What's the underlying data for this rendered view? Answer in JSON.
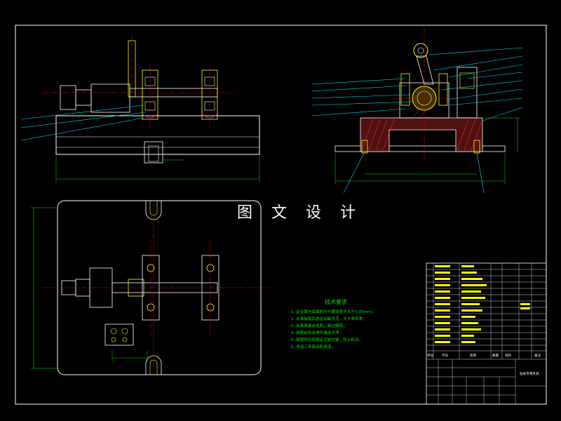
{
  "watermark": "图 文 设 计",
  "technical_requirements": {
    "title": "技术要求",
    "items": [
      "1. 定位面与底面的平行度误差不大于0.05mm；",
      "2. 夹具装配后各运动副灵活，无卡滞现象；",
      "3. 夹具表面去毛刺，锐边倒钝；",
      "4. 装配前所有零件清洗干净；",
      "5. 紧固件应按规定力矩拧紧，防止松动；",
      "6. 非加工表面涂防锈漆。"
    ]
  },
  "title_block": {
    "drawing_name": "钻床专用夹具",
    "columns": [
      "序号",
      "代号",
      "名称",
      "数量",
      "材料",
      "备注"
    ]
  },
  "colors": {
    "background": "#000000",
    "outline": "#ffffff",
    "centerline": "#ff0000",
    "dimension": "#00e000",
    "leader": "#00e5ff",
    "part": "#ffff00",
    "hatch": "#ff3030",
    "detail": "#ff00ff"
  }
}
